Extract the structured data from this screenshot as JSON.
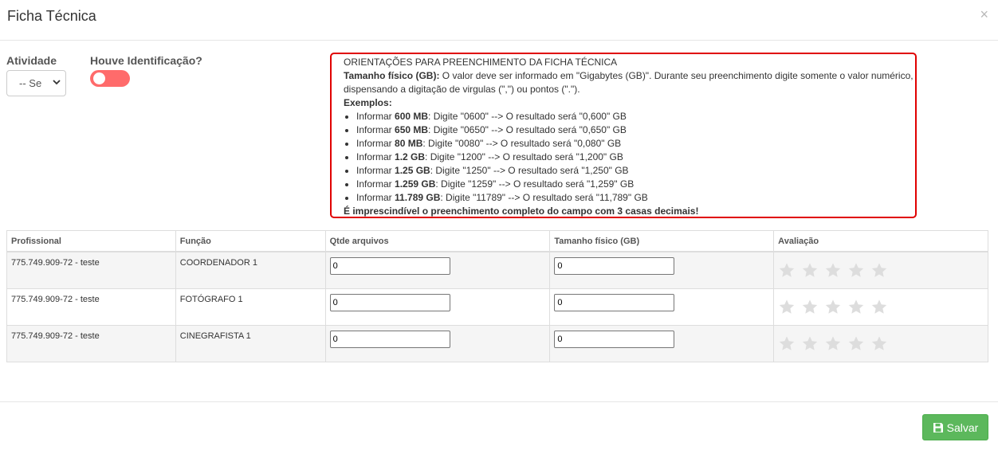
{
  "modal": {
    "title": "Ficha Técnica",
    "close_symbol": "×"
  },
  "form": {
    "atividade_label": "Atividade",
    "atividade_value": "-- Se",
    "identificacao_label": "Houve Identificação?",
    "identificacao_on": false,
    "toggle_color": "#ff6b6b"
  },
  "orientacoes": {
    "title": "ORIENTAÇÕES PARA PREENCHIMENTO DA FICHA TÉCNICA",
    "tamanho_label": "Tamanho físico (GB):",
    "tamanho_text": " O valor deve ser informado em \"Gigabytes (GB)\". Durante seu preenchimento digite somente o valor numérico, dispensando a digitação de virgulas (\",\") ou pontos (\".\").",
    "exemplos_label": "Exemplos:",
    "examples": [
      {
        "prefix": "Informar ",
        "bold": "600 MB",
        "rest": ": Digite \"0600\" --> O resultado será \"0,600\" GB"
      },
      {
        "prefix": "Informar ",
        "bold": "650 MB",
        "rest": ": Digite \"0650\" --> O resultado será \"0,650\" GB"
      },
      {
        "prefix": "Informar ",
        "bold": "80 MB",
        "rest": ": Digite \"0080\" --> O resultado será \"0,080\" GB"
      },
      {
        "prefix": "Informar ",
        "bold": "1.2 GB",
        "rest": ": Digite \"1200\" --> O resultado será \"1,200\" GB"
      },
      {
        "prefix": "Informar ",
        "bold": "1.25 GB",
        "rest": ": Digite \"1250\" --> O resultado será \"1,250\" GB"
      },
      {
        "prefix": "Informar ",
        "bold": "1.259 GB",
        "rest": ": Digite \"1259\" --> O resultado será \"1,259\" GB"
      },
      {
        "prefix": "Informar ",
        "bold": "11.789 GB",
        "rest": ": Digite \"11789\" --> O resultado será \"11,789\" GB"
      }
    ],
    "footer": "É imprescindível o preenchimento completo do campo com 3 casas decimais!",
    "border_color": "#e00000"
  },
  "table": {
    "headers": [
      "Profissional",
      "Função",
      "Qtde arquivos",
      "Tamanho físico (GB)",
      "Avaliação"
    ],
    "rows": [
      {
        "profissional": "775.749.909-72 - teste",
        "funcao": "COORDENADOR 1",
        "qtde": "0",
        "tamanho": "0",
        "rating": 0
      },
      {
        "profissional": "775.749.909-72 - teste",
        "funcao": "FOTÓGRAFO 1",
        "qtde": "0",
        "tamanho": "0",
        "rating": 0
      },
      {
        "profissional": "775.749.909-72 - teste",
        "funcao": "CINEGRAFISTA 1",
        "qtde": "0",
        "tamanho": "0",
        "rating": 0
      }
    ],
    "max_stars": 5,
    "star_empty_color": "#dddddd"
  },
  "footer": {
    "save_label": "Salvar",
    "save_color": "#5cb85c"
  }
}
